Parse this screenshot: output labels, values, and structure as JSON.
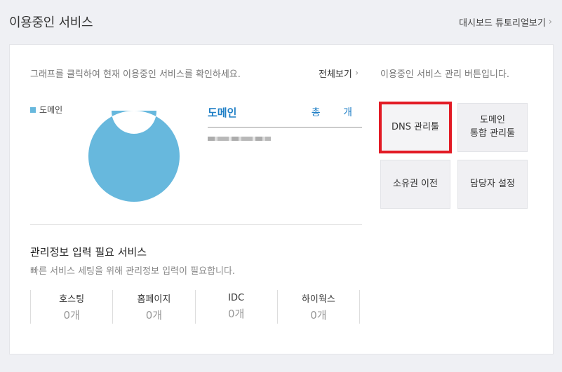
{
  "header": {
    "title": "이용중인 서비스",
    "tutorial_link": "대시보드 튜토리얼보기"
  },
  "left_panel": {
    "description": "그래프를 클릭하여 현재 이용중인 서비스를 확인하세요.",
    "view_all": "전체보기",
    "legend_label": "도메인",
    "legend_color": "#67b8dd",
    "domain_title": "도메인",
    "domain_total": "총 개"
  },
  "right_panel": {
    "description": "이용중인 서비스 관리 버튼입니다.",
    "buttons": [
      {
        "label": "DNS 관리툴"
      },
      {
        "label": "도메인\n통합 관리툴"
      },
      {
        "label": "소유권 이전"
      },
      {
        "label": "담당자 설정"
      }
    ],
    "highlight_color": "#e21b25"
  },
  "required": {
    "title": "관리정보 입력 필요 서비스",
    "description": "빠른 서비스 세팅을 위해 관리정보 입력이 필요합니다.",
    "items": [
      {
        "label": "호스팅",
        "value": "0개"
      },
      {
        "label": "홈페이지",
        "value": "0개"
      },
      {
        "label": "IDC",
        "value": "0개"
      },
      {
        "label": "하이웍스",
        "value": "0개"
      }
    ]
  },
  "chart_data": {
    "type": "pie",
    "categories": [
      "도메인"
    ],
    "values": [
      100
    ],
    "colors": [
      "#67b8dd"
    ]
  }
}
